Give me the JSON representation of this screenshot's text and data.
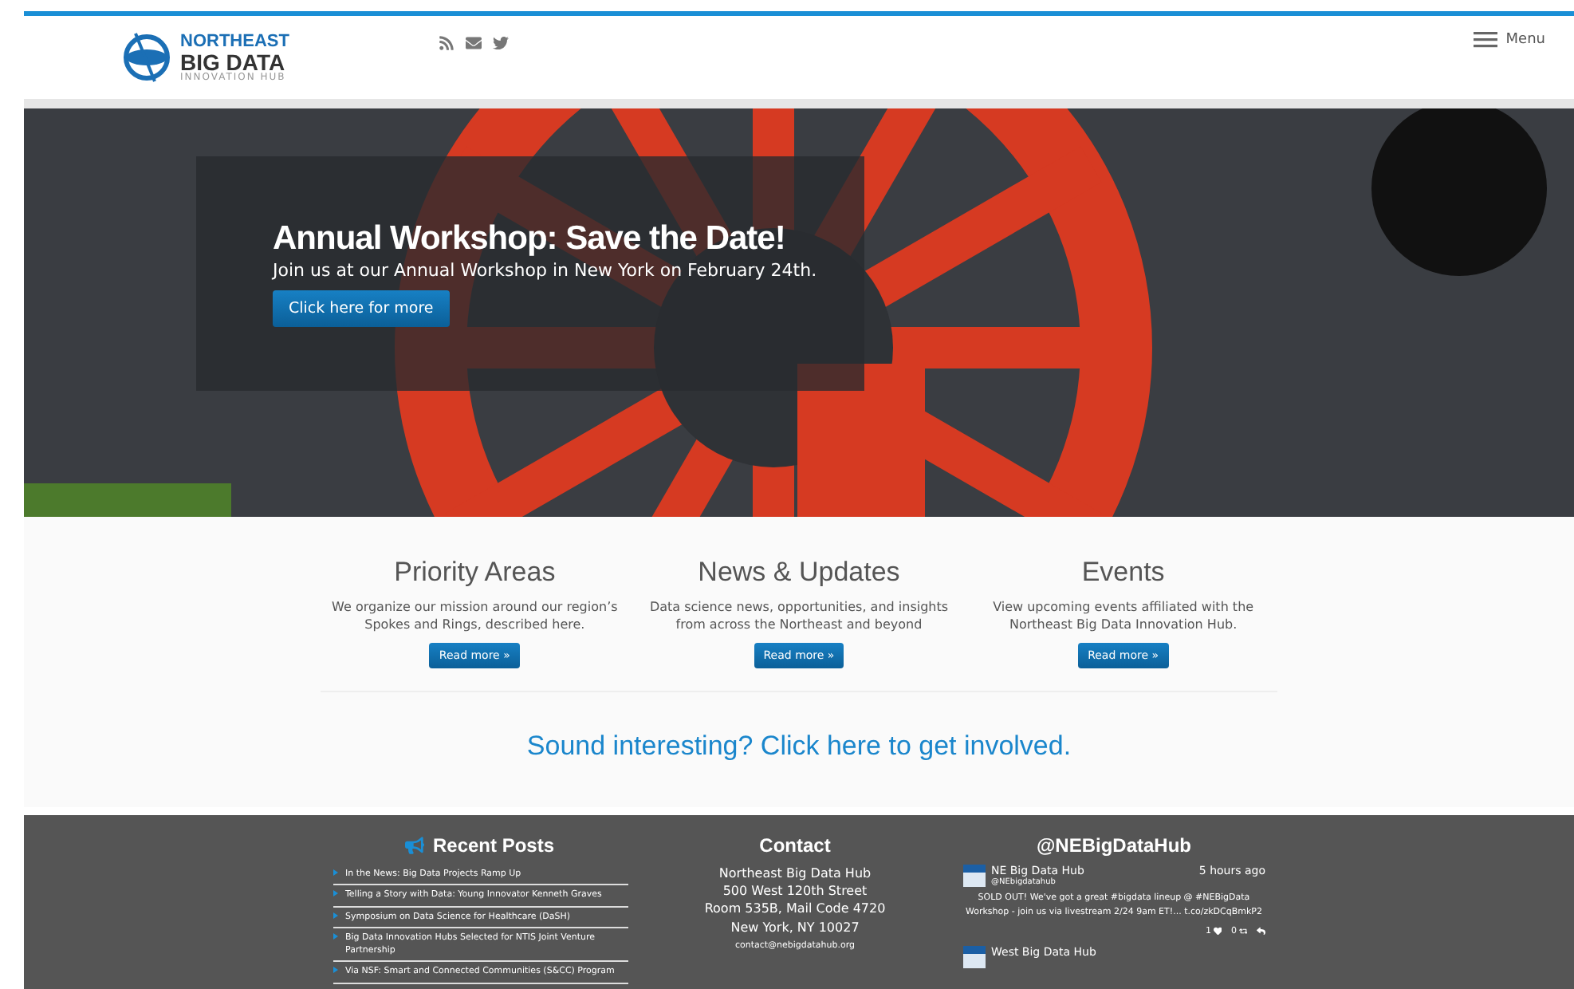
{
  "header": {
    "logo": {
      "line1": "NORTHEAST",
      "line2": "BIG DATA",
      "line3": "INNOVATION HUB"
    },
    "menu": "Menu"
  },
  "hero": {
    "title": "Annual Workshop: Save the Date!",
    "text": "Join us at our Annual Workshop in New York on February 24th.",
    "button": "Click here for more"
  },
  "features": [
    {
      "title": "Priority Areas",
      "text": "We organize our mission around our region’s Spokes and Rings, described here.",
      "button": "Read more »"
    },
    {
      "title": "News & Updates",
      "text": "Data science news, opportunities, and insights from across the Northeast and beyond",
      "button": "Read more »"
    },
    {
      "title": "Events",
      "text": "View upcoming events affiliated with the Northeast Big Data Innovation Hub.",
      "button": "Read more »"
    }
  ],
  "cta": "Sound interesting? Click here to get involved.",
  "footer": {
    "recent_posts": {
      "title": "Recent Posts",
      "items": [
        "In the News: Big Data Projects Ramp Up",
        "Telling a Story with Data: Young Innovator Kenneth Graves",
        "Symposium on Data Science for Healthcare (DaSH)",
        "Big Data Innovation Hubs Selected for NTIS Joint Venture Partnership",
        "Via NSF: Smart and Connected Communities (S&CC) Program"
      ]
    },
    "contact": {
      "title": "Contact",
      "lines": [
        "Northeast Big Data Hub",
        "500 West 120th Street",
        "Room 535B, Mail Code 4720",
        "New York, NY 10027"
      ],
      "email": "contact@nebigdatahub.org"
    },
    "twitter": {
      "title": "@NEBigDataHub",
      "tweets": [
        {
          "name": "NE Big Data Hub",
          "handle": "@NEbigdatahub",
          "time": "5 hours ago",
          "text": "SOLD OUT! We've got a great #bigdata lineup @ #NEBigData Workshop - join us via livestream 2/24 9am ET!... t.co/zkDCqBmkP2",
          "likes": "1",
          "retweets": "0"
        },
        {
          "name": "West Big Data Hub"
        }
      ]
    }
  }
}
